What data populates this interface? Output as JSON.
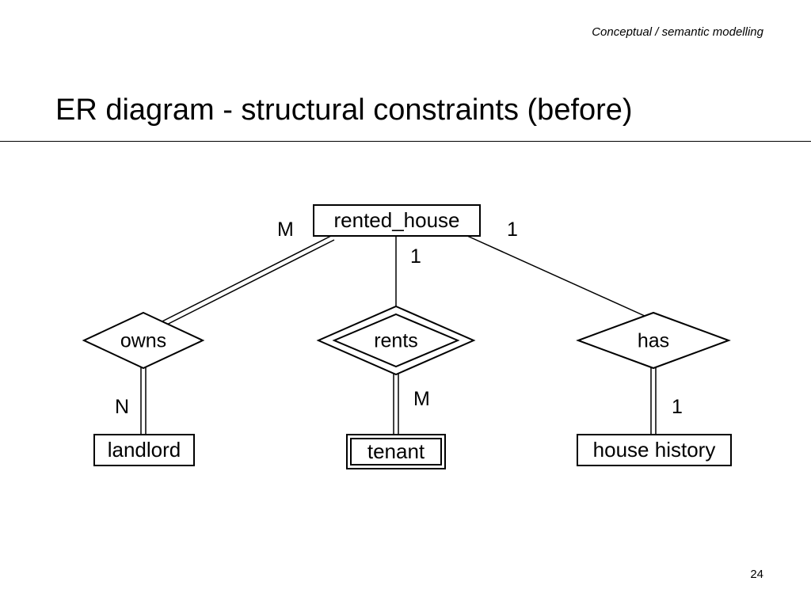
{
  "header": {
    "context": "Conceptual / semantic modelling"
  },
  "title": "ER diagram - structural constraints (before)",
  "page_number": "24",
  "entities": {
    "rented_house": {
      "label": "rented_house",
      "kind": "entity",
      "double": false
    },
    "landlord": {
      "label": "landlord",
      "kind": "entity",
      "double": false
    },
    "tenant": {
      "label": "tenant",
      "kind": "weak_entity",
      "double": true
    },
    "house_history": {
      "label": "house history",
      "kind": "entity",
      "double": false
    }
  },
  "relationships": {
    "owns": {
      "label": "owns",
      "kind": "relationship",
      "double": false
    },
    "rents": {
      "label": "rents",
      "kind": "identifying_relationship",
      "double": true
    },
    "has": {
      "label": "has",
      "kind": "relationship",
      "double": false
    }
  },
  "edges": [
    {
      "from": "rented_house",
      "to": "owns",
      "cardinality": "M",
      "participation": "total"
    },
    {
      "from": "owns",
      "to": "landlord",
      "cardinality": "N",
      "participation": "total"
    },
    {
      "from": "rented_house",
      "to": "rents",
      "cardinality": "1",
      "participation": "partial"
    },
    {
      "from": "rents",
      "to": "tenant",
      "cardinality": "M",
      "participation": "total"
    },
    {
      "from": "rented_house",
      "to": "has",
      "cardinality": "1",
      "participation": "partial"
    },
    {
      "from": "has",
      "to": "house_history",
      "cardinality": "1",
      "participation": "total"
    }
  ],
  "cardinality_labels": {
    "owns_top": "M",
    "owns_bottom": "N",
    "rents_top": "1",
    "rents_bottom": "M",
    "has_top": "1",
    "has_bottom": "1"
  }
}
